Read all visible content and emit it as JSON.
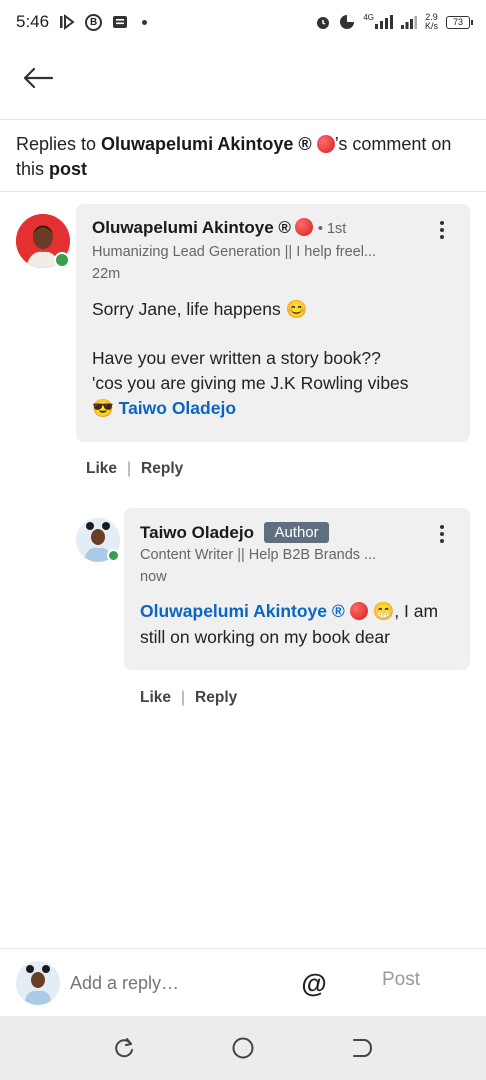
{
  "status_bar": {
    "time": "5:46",
    "network_type": "4G",
    "speed_value": "2.9",
    "speed_unit": "K/s",
    "battery": "73"
  },
  "header": {
    "back_icon": "arrow-left-icon",
    "replies_prefix": "Replies to ",
    "replies_name": "Oluwapelumi Akintoye ®",
    "replies_mid": "’s comment on this ",
    "replies_link": "post"
  },
  "parent_comment": {
    "author": "Oluwapelumi Akintoye ®",
    "degree": "• 1st",
    "headline": "Humanizing Lead Generation || I help freel...",
    "time": "22m",
    "line1": "Sorry Jane, life happens 😊",
    "line2": "Have you ever written a story book??",
    "line3": "'cos you are giving me J.K Rowling vibes",
    "line4_emoji": "😎",
    "mention": "Taiwo Oladejo",
    "like_label": "Like",
    "reply_label": "Reply"
  },
  "reply_comment": {
    "author": "Taiwo Oladejo",
    "badge": "Author",
    "headline": "Content Writer || Help B2B Brands ...",
    "time": "now",
    "mention": "Oluwapelumi Akintoye ®",
    "text_after_mention": " 😁, I am",
    "line2": "still on working on my book dear",
    "like_label": "Like",
    "reply_label": "Reply"
  },
  "reply_bar": {
    "placeholder": "Add a reply…",
    "at_symbol": "@",
    "post_label": "Post"
  },
  "colors": {
    "accent": "#0a66c2",
    "online": "#3a9d4a",
    "badge_bg": "#5f6f80",
    "bubble_bg": "#f0f0f0"
  }
}
